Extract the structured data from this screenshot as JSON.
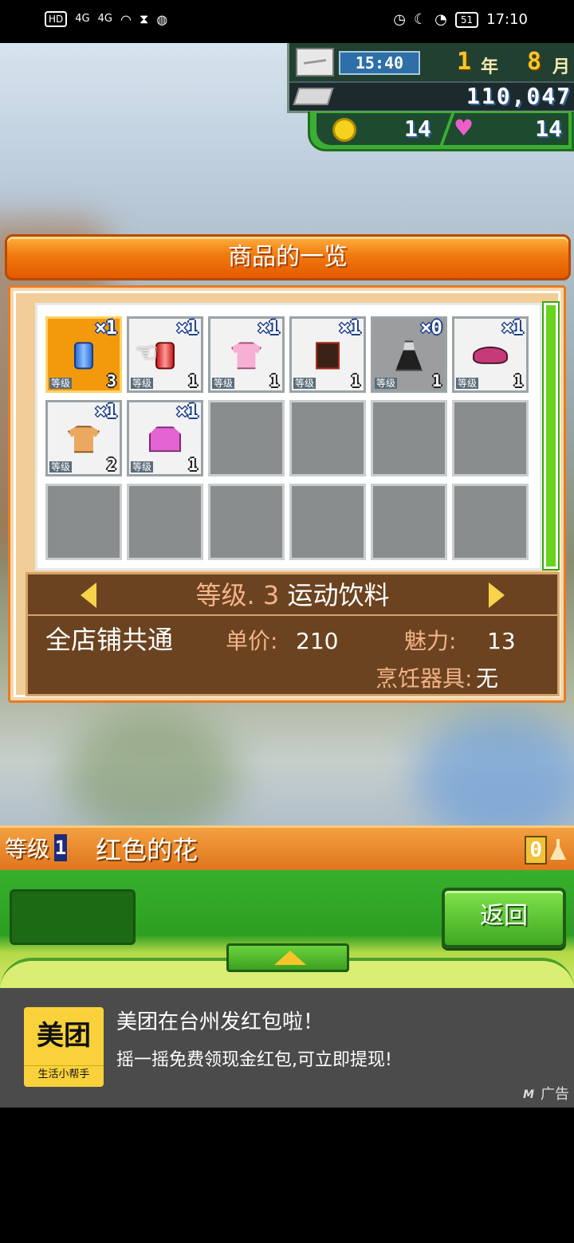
{
  "statusbar": {
    "left_chips": [
      "HD",
      "4G",
      "4G"
    ],
    "battery": "51",
    "time": "17:10",
    "icons": [
      "hd-icon",
      "signal-icon",
      "signal-icon",
      "wifi-icon",
      "hourglass-icon",
      "wechat-icon",
      "boss-app-icon",
      "alarm-icon",
      "moon-icon",
      "speed-icon",
      "battery-icon"
    ]
  },
  "hud": {
    "clock": "15:40",
    "year": "1",
    "year_unit": "年",
    "month": "8",
    "month_unit": "月",
    "money": "110,047",
    "coins": "14",
    "hearts": "14"
  },
  "panel": {
    "title": "商品的一览",
    "slot_level_tag": "等级",
    "items": [
      {
        "qty": "×1",
        "level": "3",
        "icon": "blue-drink-can-icon",
        "selected": true
      },
      {
        "qty": "×1",
        "level": "1",
        "icon": "red-drink-can-icon",
        "selected": false
      },
      {
        "qty": "×1",
        "level": "1",
        "icon": "pink-shirt-icon",
        "selected": false
      },
      {
        "qty": "×1",
        "level": "1",
        "icon": "dark-jacket-icon",
        "selected": false
      },
      {
        "qty": "×0",
        "level": "1",
        "icon": "dress-icon",
        "selected": false
      },
      {
        "qty": "×1",
        "level": "1",
        "icon": "hat-icon",
        "selected": false
      },
      {
        "qty": "×1",
        "level": "2",
        "icon": "tan-shirt-icon",
        "selected": false
      },
      {
        "qty": "×1",
        "level": "1",
        "icon": "pink-vest-icon",
        "selected": false
      }
    ],
    "info": {
      "level_text": "等级. 3",
      "item_name": "运动饮料",
      "shared": "全店铺共通",
      "price_label": "单价:",
      "price_value": "210",
      "charm_label": "魅力:",
      "charm_value": "13",
      "cookware_label": "烹饪器具:",
      "cookware_value": "无"
    }
  },
  "selection": {
    "level_label": "等级",
    "level_value": "1",
    "name": "红色的花",
    "count": "0"
  },
  "buttons": {
    "back": "返回"
  },
  "ad": {
    "logo_main": "美团",
    "logo_sub": "生活小帮手",
    "title": "美团在台州发红包啦！",
    "desc": "摇一摇免费领现金红包,可立即提现!",
    "tag": "广告",
    "tag_icon": "M"
  },
  "colors": {
    "title_orange": "#f07a10",
    "panel_brown": "#6b4320",
    "selected_slot": "#f29a0c",
    "green": "#3fa822"
  }
}
